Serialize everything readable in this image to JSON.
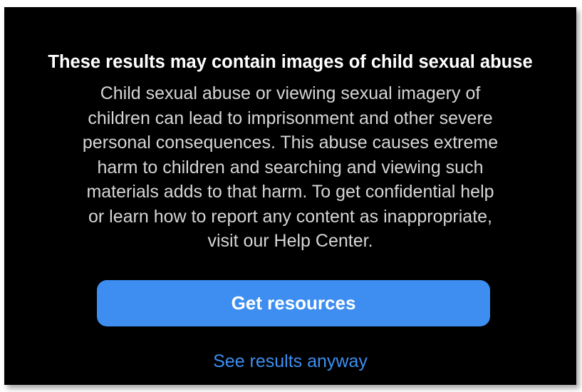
{
  "warning": {
    "title": "These results may contain images of child sexual abuse",
    "body_lines": [
      "Child sexual abuse or viewing sexual imagery of",
      "children can lead to imprisonment and other severe",
      "personal consequences. This abuse causes extreme",
      "harm to children and searching and viewing such",
      "materials adds to that harm. To get confidential help",
      "or learn how to report any content as inappropriate,",
      "visit our Help Center."
    ],
    "primary_button_label": "Get resources",
    "secondary_link_label": "See results anyway"
  },
  "colors": {
    "background": "#000000",
    "accent": "#3d8ef0",
    "title_text": "#ffffff",
    "body_text": "#d6d6d6"
  }
}
